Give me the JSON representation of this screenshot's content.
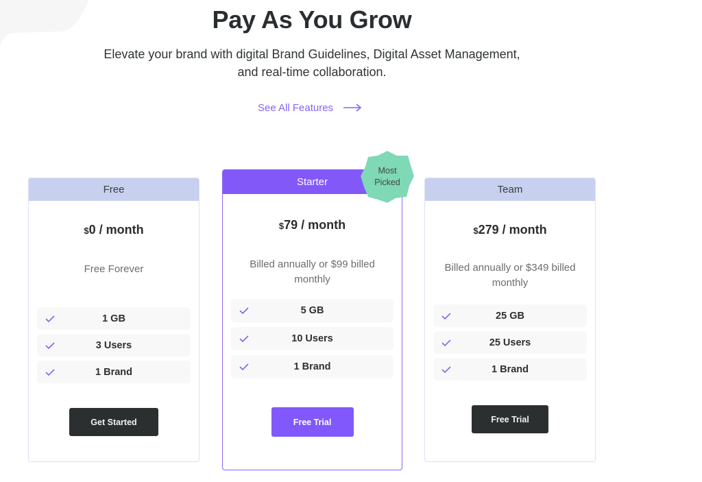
{
  "hero": {
    "title": "Pay As You Grow",
    "subtitle": "Elevate your brand with digital Brand Guidelines, Digital Asset Management, and real-time collaboration.",
    "link_label": "See All Features",
    "link_icon": "arrow-right-icon"
  },
  "colors": {
    "accent": "#8358f8",
    "header_muted": "#c7d0ee",
    "badge": "#7fd8b6",
    "dark_button": "#2b2f30",
    "check": "#8663f4"
  },
  "plans": [
    {
      "name": "Free",
      "currency": "$",
      "price": "0",
      "period": " / month",
      "billing": "Free Forever",
      "features": [
        "1 GB",
        "3 Users",
        "1 Brand"
      ],
      "cta": "Get Started"
    },
    {
      "name": "Starter",
      "currency": "$",
      "price": "79",
      "period": " / month",
      "billing": "Billed annually or $99 billed monthly",
      "features": [
        "5 GB",
        "10 Users",
        "1 Brand"
      ],
      "cta": "Free Trial",
      "badge": "Most Picked"
    },
    {
      "name": "Team",
      "currency": "$",
      "price": "279",
      "period": " / month",
      "billing": "Billed annually or $349 billed monthly",
      "features": [
        "25 GB",
        "25 Users",
        "1 Brand"
      ],
      "cta": "Free Trial"
    }
  ],
  "badge": {
    "line1": "Most",
    "line2": "Picked"
  }
}
